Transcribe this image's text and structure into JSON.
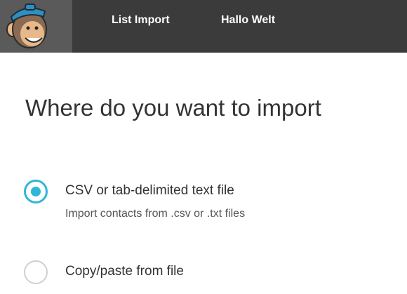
{
  "header": {
    "logo": "mailchimp-freddie-logo",
    "nav": [
      {
        "label": "List Import"
      },
      {
        "label": "Hallo Welt"
      }
    ]
  },
  "main": {
    "title": "Where do you want to import",
    "options": [
      {
        "title": "CSV or tab-delimited text file",
        "description": "Import contacts from .csv or .txt files",
        "selected": true
      },
      {
        "title": "Copy/paste from file",
        "selected": false
      }
    ]
  },
  "colors": {
    "topbar": "#3b3b3b",
    "logo_bg": "#5a5a5a",
    "accent": "#2fb6d8",
    "text": "#333333"
  }
}
